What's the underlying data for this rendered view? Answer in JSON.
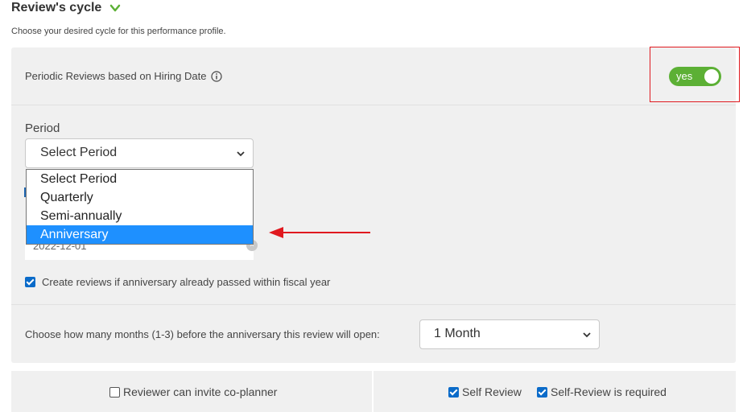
{
  "section": {
    "title": "Review's cycle",
    "subtitle": "Choose your desired cycle for this performance profile."
  },
  "periodic": {
    "label": "Periodic Reviews based on Hiring Date",
    "toggle_text": "yes",
    "toggle_on": true
  },
  "period": {
    "label": "Period",
    "selected": "Select Period",
    "options": [
      "Select Period",
      "Quarterly",
      "Semi-annually",
      "Anniversary"
    ],
    "highlighted_index": 3
  },
  "date_field": {
    "value": "2022-12-01"
  },
  "create_reviews": {
    "label": "Create reviews if anniversary already passed within fiscal year",
    "checked": true
  },
  "months": {
    "label": "Choose how many months (1-3) before the anniversary this review will open:",
    "selected": "1 Month"
  },
  "bottom": {
    "invite_label": "Reviewer can invite co-planner",
    "invite_checked": false,
    "self_review_label": "Self Review",
    "self_review_checked": true,
    "self_required_label": "Self-Review is required",
    "self_required_checked": true
  },
  "colors": {
    "toggle_green": "#5cb035",
    "highlight_red": "#e0191f",
    "selection_blue": "#1e90ff",
    "checkbox_blue": "#0b6bc9"
  },
  "icons": [
    "chevron-down-icon",
    "info-icon",
    "select-caret-icon",
    "clear-icon",
    "red-arrow-icon"
  ]
}
